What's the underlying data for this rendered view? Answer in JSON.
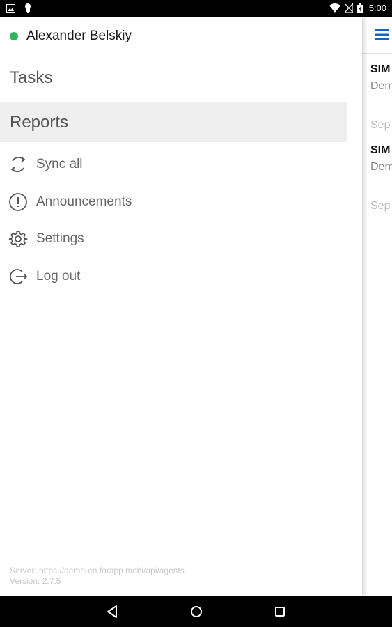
{
  "status_bar": {
    "time": "5:00"
  },
  "drawer": {
    "user_name": "Alexander Belskiy",
    "nav": {
      "tasks": "Tasks",
      "reports": "Reports"
    },
    "actions": {
      "sync": "Sync all",
      "announcements": "Announcements",
      "settings": "Settings",
      "logout": "Log out"
    },
    "footer": {
      "server": "Server: https://demo-en.forapp.mobi/api/agents",
      "version": "Version: 2.7.5"
    }
  },
  "content": {
    "cards": [
      {
        "title": "SIM",
        "subtitle": "Dem",
        "date": "Sep"
      },
      {
        "title": "SIM",
        "subtitle": "Dem",
        "date": "Sep"
      }
    ]
  },
  "colors": {
    "accent": "#1565c0",
    "online": "#2bb65a",
    "selected_bg": "#efefef"
  }
}
